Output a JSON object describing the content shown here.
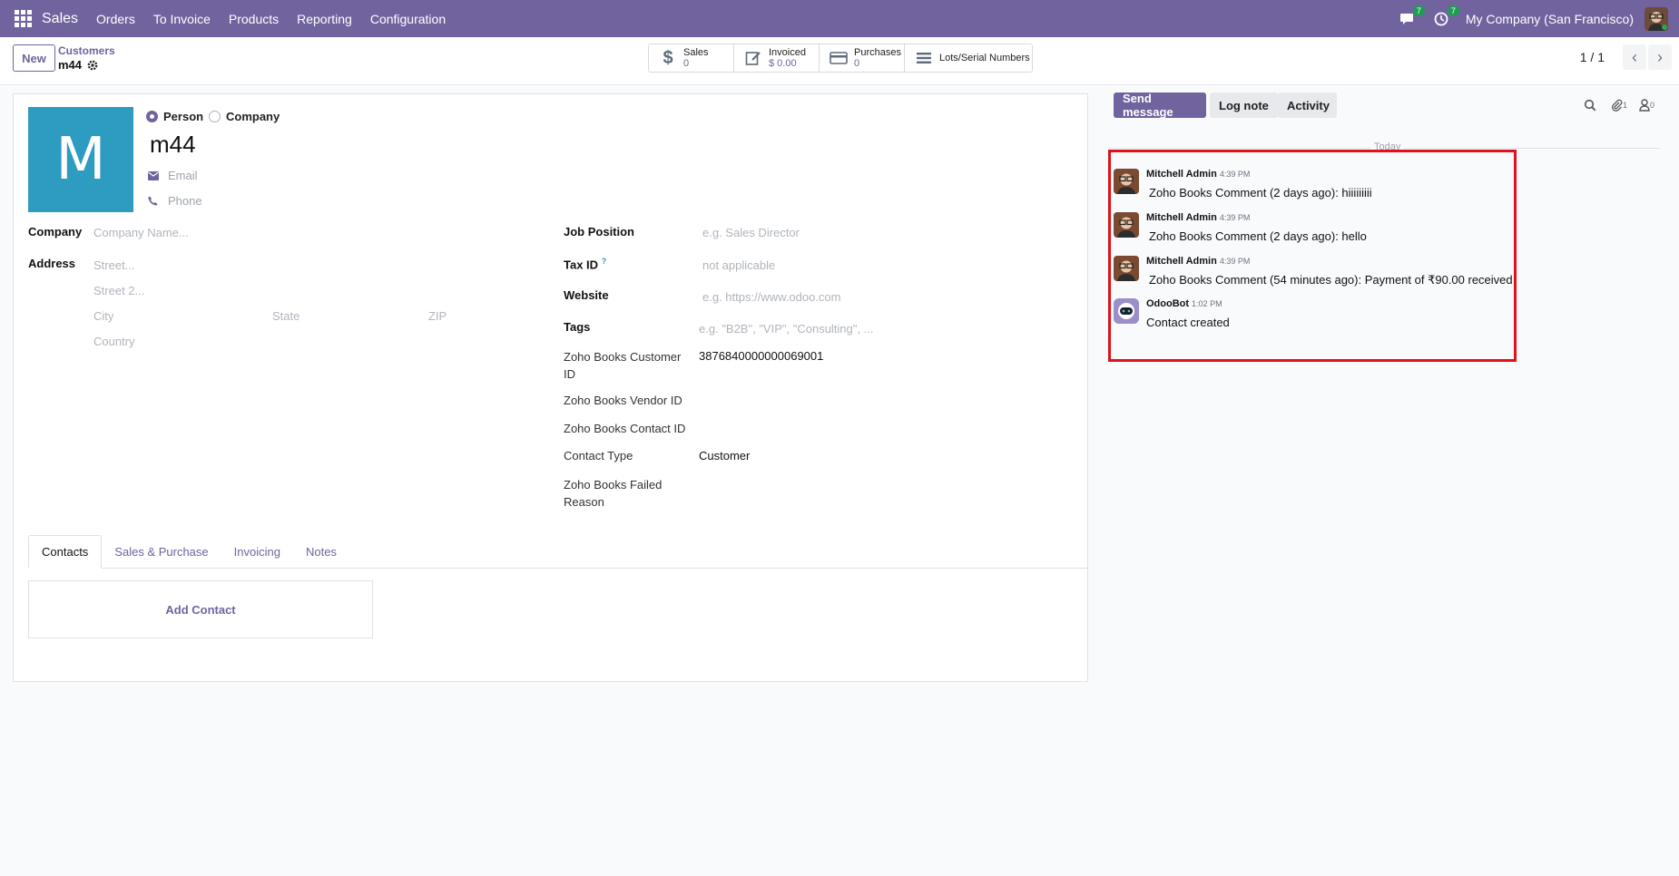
{
  "navbar": {
    "app_name": "Sales",
    "menu": [
      "Orders",
      "To Invoice",
      "Products",
      "Reporting",
      "Configuration"
    ],
    "messages_count": "7",
    "activities_count": "7",
    "company": "My Company (San Francisco)"
  },
  "control_panel": {
    "new_label": "New",
    "breadcrumb_parent": "Customers",
    "breadcrumb_current": "m44",
    "stats": [
      {
        "label": "Sales",
        "value": "0",
        "icon": "dollar-icon"
      },
      {
        "label": "Invoiced",
        "value": "$ 0.00",
        "icon": "edit-icon"
      },
      {
        "label": "Purchases",
        "value": "0",
        "icon": "credit-card-icon"
      },
      {
        "label": "Lots/Serial Numbers",
        "value": "",
        "icon": "list-icon"
      }
    ],
    "pager": "1 / 1"
  },
  "form": {
    "avatar_letter": "M",
    "type_person": "Person",
    "type_company": "Company",
    "selected_type": "Person",
    "name": "m44",
    "email_placeholder": "Email",
    "phone_placeholder": "Phone",
    "company_label": "Company",
    "company_placeholder": "Company Name...",
    "address_label": "Address",
    "street_placeholder": "Street...",
    "street2_placeholder": "Street 2...",
    "city_placeholder": "City",
    "state_placeholder": "State",
    "zip_placeholder": "ZIP",
    "country_placeholder": "Country",
    "job_position_label": "Job Position",
    "job_position_placeholder": "e.g. Sales Director",
    "tax_id_label": "Tax ID",
    "tax_id_help": "?",
    "tax_id_placeholder": "not applicable",
    "website_label": "Website",
    "website_placeholder": "e.g. https://www.odoo.com",
    "tags_label": "Tags",
    "tags_placeholder": "e.g. \"B2B\", \"VIP\", \"Consulting\", ...",
    "zoho_customer_id_label_1": "Zoho Books Customer",
    "zoho_customer_id_label_2": "ID",
    "zoho_customer_id_value": "3876840000000069001",
    "zoho_vendor_id_label": "Zoho Books Vendor ID",
    "zoho_contact_id_label": "Zoho Books Contact ID",
    "contact_type_label": "Contact Type",
    "contact_type_value": "Customer",
    "zoho_failed_label_1": "Zoho Books Failed",
    "zoho_failed_label_2": "Reason"
  },
  "tabs": [
    "Contacts",
    "Sales & Purchase",
    "Invoicing",
    "Notes"
  ],
  "add_contact_label": "Add Contact",
  "chatter": {
    "send_message": "Send message",
    "log_note": "Log note",
    "activity": "Activity",
    "attachments_count": "1",
    "followers_count": "0",
    "date_separator": "Today",
    "messages": [
      {
        "author": "Mitchell Admin",
        "time": "4:39 PM",
        "body": "Zoho Books Comment (2 days ago): hiiiiiiiii"
      },
      {
        "author": "Mitchell Admin",
        "time": "4:39 PM",
        "body": "Zoho Books Comment (2 days ago): hello"
      },
      {
        "author": "Mitchell Admin",
        "time": "4:39 PM",
        "body": "Zoho Books Comment (54 minutes ago): Payment of ₹90.00 received"
      },
      {
        "author": "OdooBot",
        "time": "1:02 PM",
        "body": "Contact created"
      }
    ]
  },
  "colors": {
    "navbar": "#71639e",
    "accent": "#71639e",
    "avatar": "#2e9bc1",
    "highlight": "#e0111b"
  }
}
